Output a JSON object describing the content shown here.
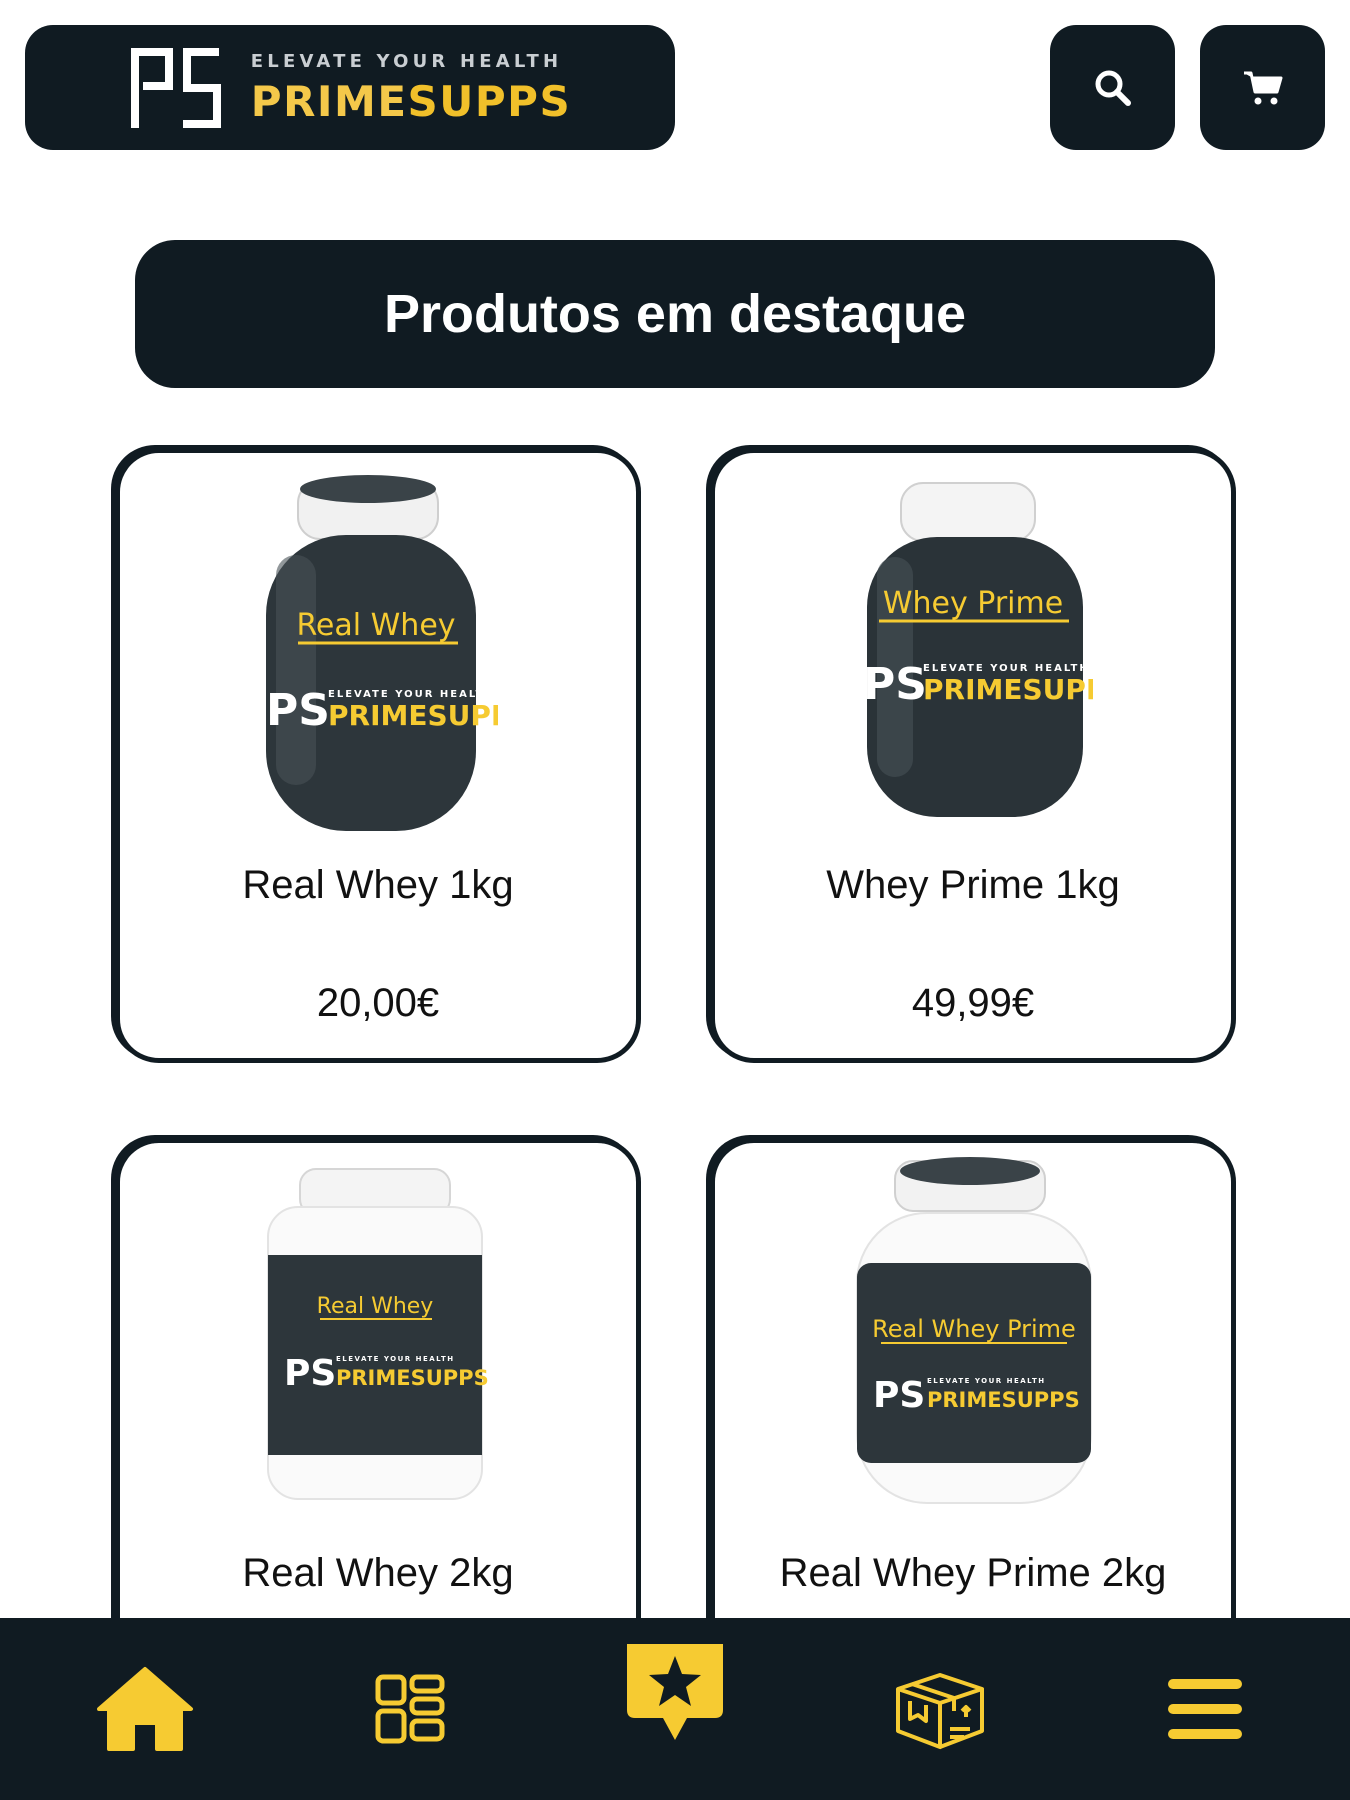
{
  "header": {
    "logo": {
      "mark": "PS",
      "tagline": "ELEVATE YOUR HEALTH",
      "brand_prime": "PRIME",
      "brand_supps": "SUPPS"
    },
    "search_icon": "search-icon",
    "cart_icon": "cart-icon"
  },
  "section": {
    "title": "Produtos em destaque"
  },
  "products": [
    {
      "name": "Real Whey 1kg",
      "price": "20,00€",
      "label": "Real Whey",
      "jar_style": "dark",
      "brand": "PRIMESUPP"
    },
    {
      "name": "Whey Prime 1kg",
      "price": "49,99€",
      "label": "Whey Prime",
      "jar_style": "dark",
      "brand": "PRIMESUPP"
    },
    {
      "name": "Real Whey 2kg",
      "label": "Real Whey",
      "jar_style": "white",
      "brand": "PRIMESUPPS"
    },
    {
      "name": "Real Whey Prime 2kg",
      "label": "Real Whey Prime",
      "jar_style": "white",
      "brand": "PRIMESUPPS"
    }
  ],
  "bottom_nav": {
    "items": [
      {
        "icon": "home-icon"
      },
      {
        "icon": "categories-icon"
      },
      {
        "icon": "featured-star-icon"
      },
      {
        "icon": "orders-box-icon"
      },
      {
        "icon": "menu-icon"
      }
    ]
  },
  "colors": {
    "dark": "#101b22",
    "accent": "#f6cb32",
    "white": "#ffffff"
  }
}
